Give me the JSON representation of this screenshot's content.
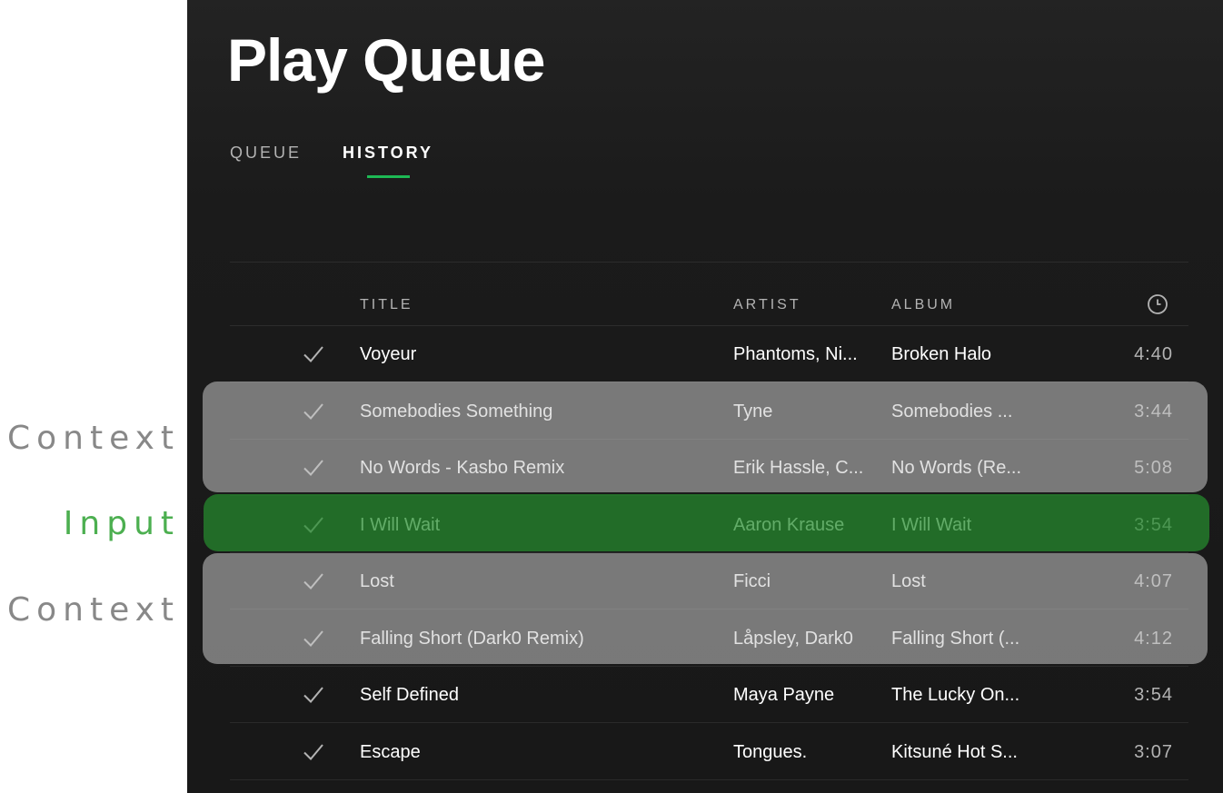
{
  "annotations": {
    "context_top": "Context",
    "input": "Input",
    "context_bottom": "Context",
    "context_color": "#888888",
    "input_color": "#4caf50"
  },
  "page": {
    "title": "Play Queue"
  },
  "tabs": [
    {
      "label": "QUEUE",
      "active": false
    },
    {
      "label": "HISTORY",
      "active": true
    }
  ],
  "accent_color": "#1db954",
  "table": {
    "headers": {
      "title": "TITLE",
      "artist": "ARTIST",
      "album": "ALBUM",
      "duration_icon": "clock-icon"
    },
    "rows": [
      {
        "title": "Voyeur",
        "artist": "Phantoms, Ni...",
        "album": "Broken Halo",
        "duration": "4:40",
        "played": true
      },
      {
        "title": "Somebodies Something",
        "artist": "Tyne",
        "album": "Somebodies ...",
        "duration": "3:44",
        "played": true
      },
      {
        "title": "No Words - Kasbo Remix",
        "artist": "Erik Hassle, C...",
        "album": "No Words (Re...",
        "duration": "5:08",
        "played": true
      },
      {
        "title": "I Will Wait",
        "artist": "Aaron Krause",
        "album": "I Will Wait",
        "duration": "3:54",
        "played": true
      },
      {
        "title": "Lost",
        "artist": "Ficci",
        "album": "Lost",
        "duration": "4:07",
        "played": true
      },
      {
        "title": "Falling Short (Dark0 Remix)",
        "artist": "Låpsley, Dark0",
        "album": "Falling Short (...",
        "duration": "4:12",
        "played": true
      },
      {
        "title": "Self Defined",
        "artist": "Maya Payne",
        "album": "The Lucky On...",
        "duration": "3:54",
        "played": true
      },
      {
        "title": "Escape",
        "artist": "Tongues.",
        "album": "Kitsuné Hot S...",
        "duration": "3:07",
        "played": true
      }
    ]
  }
}
